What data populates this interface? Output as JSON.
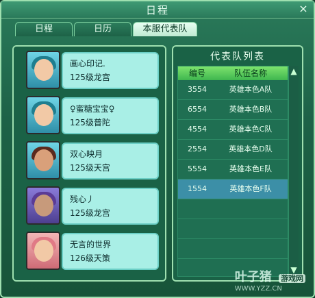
{
  "window": {
    "title": "日程",
    "close_symbol": "×"
  },
  "tabs": [
    {
      "label": "日程",
      "active": false
    },
    {
      "label": "日历",
      "active": false
    },
    {
      "label": "本服代表队",
      "active": true
    }
  ],
  "members": [
    {
      "name": "画心印记.",
      "level": "125级龙宫",
      "avatar": "teal-hair-girl"
    },
    {
      "name": "♀蜜糖宝宝♀",
      "level": "125级普陀",
      "avatar": "teal-hair-girl"
    },
    {
      "name": "双心映月",
      "level": "125级天宫",
      "avatar": "warrior-boy"
    },
    {
      "name": "残心丿",
      "level": "125级龙宫",
      "avatar": "purple-hair-boy"
    },
    {
      "name": "无言的世界",
      "level": "126级天策",
      "avatar": "red-ornament-girl"
    }
  ],
  "team_list": {
    "title": "代表队列表",
    "headers": [
      "编号",
      "队伍名称"
    ],
    "rows": [
      {
        "id": "3554",
        "team": "英雄本色A队",
        "selected": false
      },
      {
        "id": "6554",
        "team": "英雄本色B队",
        "selected": false
      },
      {
        "id": "4554",
        "team": "英雄本色C队",
        "selected": false
      },
      {
        "id": "2554",
        "team": "英雄本色D队",
        "selected": false
      },
      {
        "id": "5554",
        "team": "英雄本色E队",
        "selected": false
      },
      {
        "id": "1554",
        "team": "英雄本色F队",
        "selected": true
      }
    ],
    "empty_rows": 3
  },
  "watermark": {
    "main": "叶子猪",
    "badge": "游戏网",
    "url": "WWW.YZZ.CN"
  }
}
